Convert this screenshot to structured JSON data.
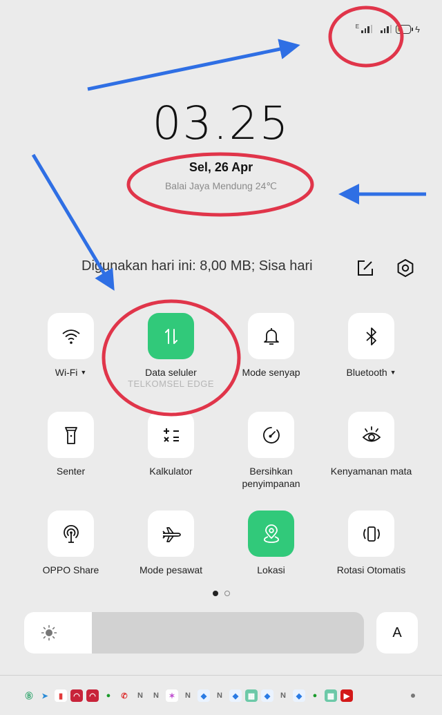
{
  "status_bar": {
    "sim1_network": "E",
    "battery_level": "6",
    "charging": true
  },
  "lockscreen": {
    "time": "03.25",
    "date": "Sel, 26 Apr",
    "weather": "Balai Jaya Mendung 24℃"
  },
  "quick_settings": {
    "data_usage_text": "Digunakan hari ini: 8,00 MB; Sisa hari",
    "edit_icon": "edit-icon",
    "settings_icon": "settings-icon",
    "tiles": [
      {
        "label": "Wi-Fi",
        "icon": "wifi-icon",
        "active": false,
        "has_dropdown": true
      },
      {
        "label": "Data seluler",
        "sublabel": "TELKOMSEL  EDGE",
        "icon": "mobile-data-icon",
        "active": true,
        "has_dropdown": false
      },
      {
        "label": "Mode senyap",
        "icon": "bell-icon",
        "active": false,
        "has_dropdown": false
      },
      {
        "label": "Bluetooth",
        "icon": "bluetooth-icon",
        "active": false,
        "has_dropdown": true
      },
      {
        "label": "Senter",
        "icon": "flashlight-icon",
        "active": false
      },
      {
        "label": "Kalkulator",
        "icon": "calculator-icon",
        "active": false
      },
      {
        "label": "Bersihkan penyimpanan",
        "icon": "gauge-icon",
        "active": false
      },
      {
        "label": "Kenyamanan mata",
        "icon": "eye-comfort-icon",
        "active": false
      },
      {
        "label": "OPPO Share",
        "icon": "oppo-share-icon",
        "active": false
      },
      {
        "label": "Mode pesawat",
        "icon": "airplane-icon",
        "active": false
      },
      {
        "label": "Lokasi",
        "icon": "location-icon",
        "active": true
      },
      {
        "label": "Rotasi Otomatis",
        "icon": "auto-rotate-icon",
        "active": false
      }
    ],
    "page_indicator": {
      "current": 1,
      "total": 2
    },
    "brightness_percent": 20,
    "auto_brightness_label": "A",
    "accent_color": "#31c97a"
  },
  "notification_icons": [
    "whatsapp-business-icon",
    "telegram-icon",
    "app-red-icon",
    "app-red-bag-icon",
    "app-red-bag-icon",
    "wechat-icon",
    "missed-call-icon",
    "n-app-icon",
    "n-app-icon",
    "star-app-icon",
    "n-app-icon",
    "blue-app-icon",
    "n-app-icon",
    "blue-app-icon",
    "green-calendar-icon",
    "blue-app-icon",
    "n-app-icon",
    "blue-app-icon",
    "wechat-icon",
    "green-calendar-icon",
    "youtube-icon"
  ],
  "annotations": {
    "circle_color": "#e0354a",
    "arrow_color": "#2f6fe4"
  }
}
